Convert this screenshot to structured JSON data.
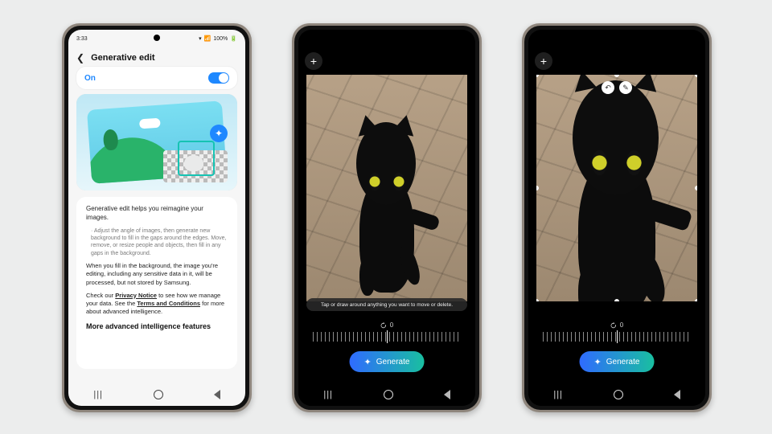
{
  "phone1": {
    "status": {
      "time": "3:33",
      "battery": "100%",
      "signal_icon": "📶",
      "wifi_icon": "▾",
      "batt_icon": "🔋"
    },
    "title": "Generative edit",
    "toggle": {
      "label": "On",
      "state": true
    },
    "illus_star_icon": "✦",
    "desc": {
      "lead": "Generative edit helps you reimagine your images.",
      "bullets": "· Adjust the angle of images, then generate new background to fill in the gaps around the edges. Move, remove, or resize people and objects, then fill in any gaps in the background.",
      "para2": "When you fill in the background, the image you're editing, including any sensitive data in it, will be processed, but not stored by Samsung.",
      "para3_a": "Check our ",
      "privacy_link": "Privacy Notice",
      "para3_b": " to see how we manage your data. See the ",
      "terms_link": "Terms and Conditions",
      "para3_c": " for more about advanced intelligence.",
      "more": "More advanced intelligence features"
    },
    "nav": {
      "recents": "|||",
      "home": "○",
      "back": "‹"
    }
  },
  "editor": {
    "plus": "+",
    "hint": "Tap or draw around anything you want to move or delete.",
    "angle_value": "0",
    "angle_icon_name": "rotate-icon",
    "generate": "Generate",
    "sparkle": "✦",
    "undo_icon": "↶",
    "erase_icon": "✎",
    "crop_handle_icon": "●"
  }
}
